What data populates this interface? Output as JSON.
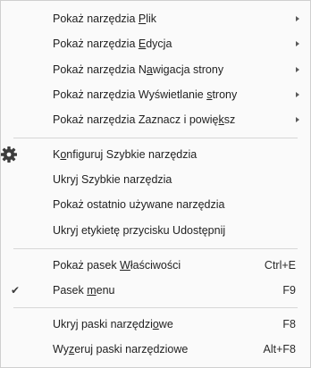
{
  "menu": {
    "items": [
      {
        "pre": "Pokaż narzędzia ",
        "acc": "P",
        "post": "lik",
        "submenu": true
      },
      {
        "pre": "Pokaż narzędzia ",
        "acc": "E",
        "post": "dycja",
        "submenu": true
      },
      {
        "pre": "Pokaż narzędzia N",
        "acc": "a",
        "post": "wigacja strony",
        "submenu": true
      },
      {
        "pre": "Pokaż narzędzia Wyświetlanie ",
        "acc": "s",
        "post": "trony",
        "submenu": true
      },
      {
        "pre": "Pokaż narzędzia Zaznacz i powię",
        "acc": "k",
        "post": "sz",
        "submenu": true
      },
      {
        "pre": "K",
        "acc": "o",
        "post": "nfiguruj Szybkie narzędzia",
        "icon": "gear-icon"
      },
      {
        "pre": "Ukryj Szybkie narzędzia",
        "acc": "",
        "post": ""
      },
      {
        "pre": "Pokaż ostatnio używane narzędzia",
        "acc": "",
        "post": ""
      },
      {
        "pre": "Ukryj etykietę przycisku Udostępnij",
        "acc": "",
        "post": ""
      },
      {
        "pre": "Pokaż pasek ",
        "acc": "W",
        "post": "łaściwości",
        "shortcut": "Ctrl+E"
      },
      {
        "pre": "Pasek ",
        "acc": "m",
        "post": "enu",
        "shortcut": "F9",
        "checked": true
      },
      {
        "pre": "Ukryj paski narzędzi",
        "acc": "o",
        "post": "we",
        "shortcut": "F8"
      },
      {
        "pre": "Wy",
        "acc": "z",
        "post": "eruj paski narzędziowe",
        "shortcut": "Alt+F8"
      }
    ],
    "check_glyph": "✔"
  }
}
